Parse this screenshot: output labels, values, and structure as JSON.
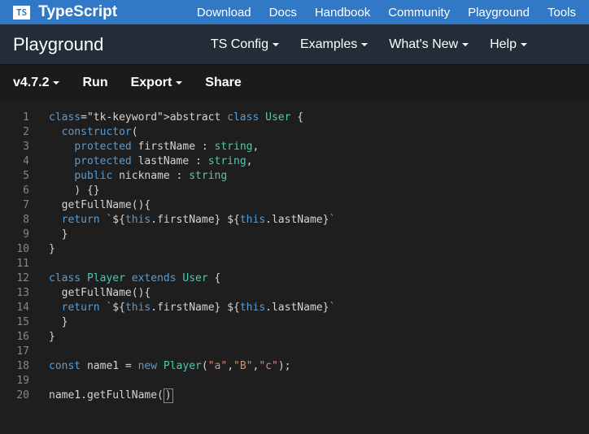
{
  "topbar": {
    "badge": "TS",
    "title": "TypeScript",
    "links": [
      "Download",
      "Docs",
      "Handbook",
      "Community",
      "Playground",
      "Tools"
    ]
  },
  "subbar": {
    "title": "Playground",
    "menu": [
      "TS Config",
      "Examples",
      "What's New",
      "Help"
    ]
  },
  "toolbar": {
    "version": "v4.7.2",
    "run": "Run",
    "export": "Export",
    "share": "Share"
  },
  "editor": {
    "lineCount": 20
  },
  "chart_data": {
    "type": "code",
    "language": "typescript",
    "lines": [
      "abstract class User {",
      "  constructor(",
      "    protected firstName : string,",
      "    protected lastName : string,",
      "    public nickname : string",
      "    ) {}",
      "  getFullName(){",
      "  return `${this.firstName} ${this.lastName}`",
      "  }",
      "}",
      "",
      "class Player extends User {",
      "  getFullName(){",
      "  return `${this.firstName} ${this.lastName}`",
      "  }",
      "}",
      "",
      "const name1 = new Player(\"a\",\"B\",\"c\");",
      "",
      "name1.getFullName()"
    ]
  }
}
